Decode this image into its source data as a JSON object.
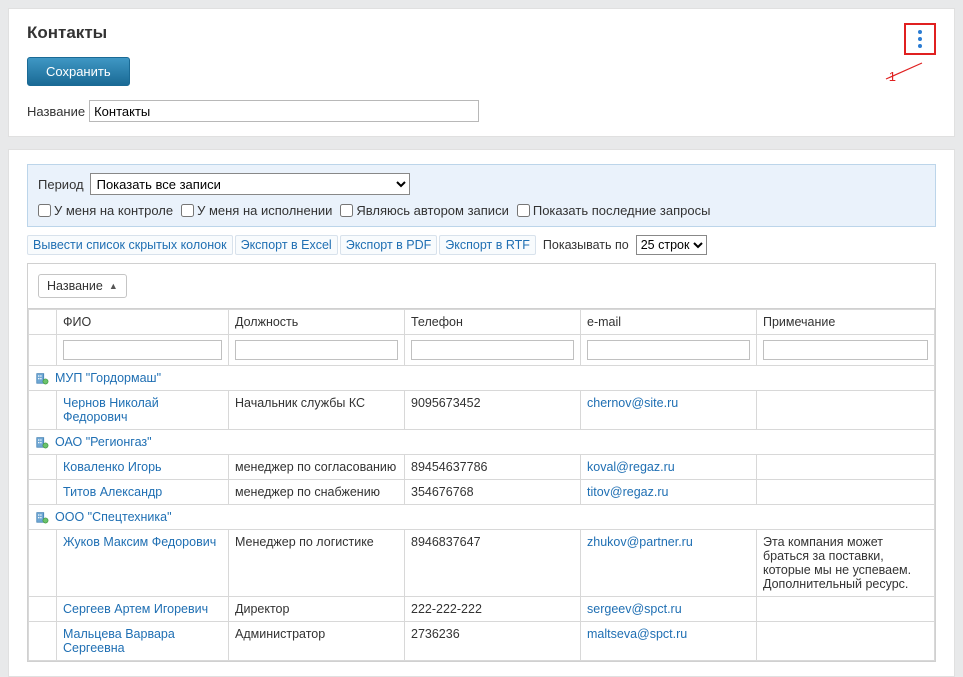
{
  "header": {
    "title": "Контакты",
    "save_label": "Сохранить"
  },
  "form": {
    "name_label": "Название",
    "name_value": "Контакты"
  },
  "filter": {
    "period_label": "Период",
    "period_selected": "Показать все записи",
    "chk_control": "У меня на контроле",
    "chk_exec": "У меня на исполнении",
    "chk_author": "Являюсь автором записи",
    "chk_recent": "Показать последние запросы"
  },
  "toolbar": {
    "hidden_cols": "Вывести список скрытых колонок",
    "export_excel": "Экспорт в Excel",
    "export_pdf": "Экспорт в PDF",
    "export_rtf": "Экспорт в RTF",
    "show_by": "Показывать по",
    "rows_selected": "25 строк"
  },
  "grid": {
    "group_by": "Название",
    "columns": {
      "fio": "ФИО",
      "position": "Должность",
      "phone": "Телефон",
      "email": "e-mail",
      "note": "Примечание"
    },
    "groups": [
      {
        "name": "МУП \"Гордормаш\"",
        "rows": [
          {
            "fio": "Чернов Николай Федорович",
            "position": "Начальник службы КС",
            "phone": "9095673452",
            "email": "chernov@site.ru",
            "note": ""
          }
        ]
      },
      {
        "name": "ОАО \"Регионгаз\"",
        "rows": [
          {
            "fio": "Коваленко Игорь",
            "position": "менеджер по согласованию",
            "phone": "89454637786",
            "email": "koval@regaz.ru",
            "note": ""
          },
          {
            "fio": "Титов Александр",
            "position": "менеджер по снабжению",
            "phone": "354676768",
            "email": "titov@regaz.ru",
            "note": ""
          }
        ]
      },
      {
        "name": "ООО \"Спецтехника\"",
        "rows": [
          {
            "fio": "Жуков Максим Федорович",
            "position": "Менеджер по логистике",
            "phone": "8946837647",
            "email": "zhukov@partner.ru",
            "note": "Эта компания может браться за поставки, которые мы не успеваем. Дополнительный ресурс."
          },
          {
            "fio": "Сергеев Артем Игоревич",
            "position": "Директор",
            "phone": "222-222-222",
            "email": "sergeev@spct.ru",
            "note": ""
          },
          {
            "fio": "Мальцева Варвара Сергеевна",
            "position": "Администратор",
            "phone": "2736236",
            "email": "maltseva@spct.ru",
            "note": ""
          }
        ]
      }
    ]
  },
  "annotation": {
    "label": "1"
  }
}
